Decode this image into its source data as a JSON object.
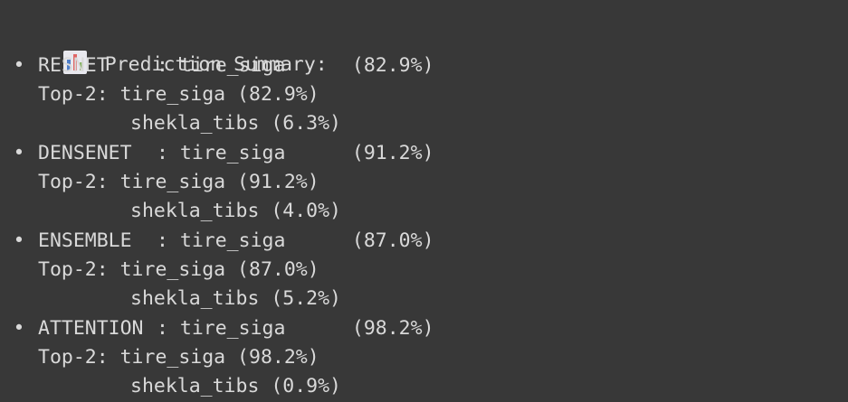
{
  "header": {
    "icon": "bar-chart-icon",
    "title": "Prediction Summary:"
  },
  "bullet_char": "•",
  "top2_prefix": "Top-2: ",
  "models": [
    {
      "name": "RESNET",
      "sep": ":",
      "prediction": "tire_siga",
      "confidence": "(82.9%)",
      "top2": [
        "tire_siga (82.9%)",
        "shekla_tibs (6.3%)"
      ]
    },
    {
      "name": "DENSENET",
      "sep": ":",
      "prediction": "tire_siga",
      "confidence": "(91.2%)",
      "top2": [
        "tire_siga (91.2%)",
        "shekla_tibs (4.0%)"
      ]
    },
    {
      "name": "ENSEMBLE",
      "sep": ":",
      "prediction": "tire_siga",
      "confidence": "(87.0%)",
      "top2": [
        "tire_siga (87.0%)",
        "shekla_tibs (5.2%)"
      ]
    },
    {
      "name": "ATTENTION",
      "sep": ":",
      "prediction": "tire_siga",
      "confidence": "(98.2%)",
      "top2": [
        "tire_siga (98.2%)",
        "shekla_tibs (0.9%)"
      ]
    }
  ],
  "colors": {
    "background": "#383838",
    "text": "#d9d9d9",
    "icon_bars": [
      "#4f7fc9",
      "#e06666",
      "#8bb66a"
    ]
  }
}
